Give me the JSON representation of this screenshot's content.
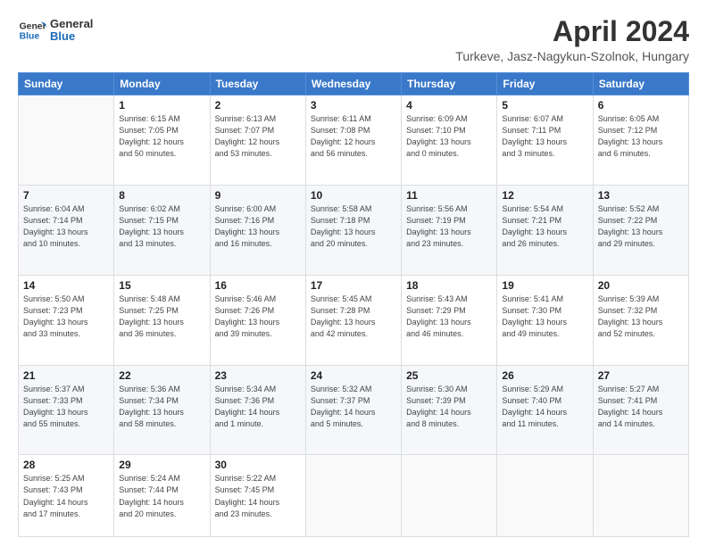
{
  "header": {
    "logo_line1": "General",
    "logo_line2": "Blue",
    "month": "April 2024",
    "location": "Turkeve, Jasz-Nagykun-Szolnok, Hungary"
  },
  "weekdays": [
    "Sunday",
    "Monday",
    "Tuesday",
    "Wednesday",
    "Thursday",
    "Friday",
    "Saturday"
  ],
  "weeks": [
    [
      {
        "day": "",
        "info": ""
      },
      {
        "day": "1",
        "info": "Sunrise: 6:15 AM\nSunset: 7:05 PM\nDaylight: 12 hours\nand 50 minutes."
      },
      {
        "day": "2",
        "info": "Sunrise: 6:13 AM\nSunset: 7:07 PM\nDaylight: 12 hours\nand 53 minutes."
      },
      {
        "day": "3",
        "info": "Sunrise: 6:11 AM\nSunset: 7:08 PM\nDaylight: 12 hours\nand 56 minutes."
      },
      {
        "day": "4",
        "info": "Sunrise: 6:09 AM\nSunset: 7:10 PM\nDaylight: 13 hours\nand 0 minutes."
      },
      {
        "day": "5",
        "info": "Sunrise: 6:07 AM\nSunset: 7:11 PM\nDaylight: 13 hours\nand 3 minutes."
      },
      {
        "day": "6",
        "info": "Sunrise: 6:05 AM\nSunset: 7:12 PM\nDaylight: 13 hours\nand 6 minutes."
      }
    ],
    [
      {
        "day": "7",
        "info": "Sunrise: 6:04 AM\nSunset: 7:14 PM\nDaylight: 13 hours\nand 10 minutes."
      },
      {
        "day": "8",
        "info": "Sunrise: 6:02 AM\nSunset: 7:15 PM\nDaylight: 13 hours\nand 13 minutes."
      },
      {
        "day": "9",
        "info": "Sunrise: 6:00 AM\nSunset: 7:16 PM\nDaylight: 13 hours\nand 16 minutes."
      },
      {
        "day": "10",
        "info": "Sunrise: 5:58 AM\nSunset: 7:18 PM\nDaylight: 13 hours\nand 20 minutes."
      },
      {
        "day": "11",
        "info": "Sunrise: 5:56 AM\nSunset: 7:19 PM\nDaylight: 13 hours\nand 23 minutes."
      },
      {
        "day": "12",
        "info": "Sunrise: 5:54 AM\nSunset: 7:21 PM\nDaylight: 13 hours\nand 26 minutes."
      },
      {
        "day": "13",
        "info": "Sunrise: 5:52 AM\nSunset: 7:22 PM\nDaylight: 13 hours\nand 29 minutes."
      }
    ],
    [
      {
        "day": "14",
        "info": "Sunrise: 5:50 AM\nSunset: 7:23 PM\nDaylight: 13 hours\nand 33 minutes."
      },
      {
        "day": "15",
        "info": "Sunrise: 5:48 AM\nSunset: 7:25 PM\nDaylight: 13 hours\nand 36 minutes."
      },
      {
        "day": "16",
        "info": "Sunrise: 5:46 AM\nSunset: 7:26 PM\nDaylight: 13 hours\nand 39 minutes."
      },
      {
        "day": "17",
        "info": "Sunrise: 5:45 AM\nSunset: 7:28 PM\nDaylight: 13 hours\nand 42 minutes."
      },
      {
        "day": "18",
        "info": "Sunrise: 5:43 AM\nSunset: 7:29 PM\nDaylight: 13 hours\nand 46 minutes."
      },
      {
        "day": "19",
        "info": "Sunrise: 5:41 AM\nSunset: 7:30 PM\nDaylight: 13 hours\nand 49 minutes."
      },
      {
        "day": "20",
        "info": "Sunrise: 5:39 AM\nSunset: 7:32 PM\nDaylight: 13 hours\nand 52 minutes."
      }
    ],
    [
      {
        "day": "21",
        "info": "Sunrise: 5:37 AM\nSunset: 7:33 PM\nDaylight: 13 hours\nand 55 minutes."
      },
      {
        "day": "22",
        "info": "Sunrise: 5:36 AM\nSunset: 7:34 PM\nDaylight: 13 hours\nand 58 minutes."
      },
      {
        "day": "23",
        "info": "Sunrise: 5:34 AM\nSunset: 7:36 PM\nDaylight: 14 hours\nand 1 minute."
      },
      {
        "day": "24",
        "info": "Sunrise: 5:32 AM\nSunset: 7:37 PM\nDaylight: 14 hours\nand 5 minutes."
      },
      {
        "day": "25",
        "info": "Sunrise: 5:30 AM\nSunset: 7:39 PM\nDaylight: 14 hours\nand 8 minutes."
      },
      {
        "day": "26",
        "info": "Sunrise: 5:29 AM\nSunset: 7:40 PM\nDaylight: 14 hours\nand 11 minutes."
      },
      {
        "day": "27",
        "info": "Sunrise: 5:27 AM\nSunset: 7:41 PM\nDaylight: 14 hours\nand 14 minutes."
      }
    ],
    [
      {
        "day": "28",
        "info": "Sunrise: 5:25 AM\nSunset: 7:43 PM\nDaylight: 14 hours\nand 17 minutes."
      },
      {
        "day": "29",
        "info": "Sunrise: 5:24 AM\nSunset: 7:44 PM\nDaylight: 14 hours\nand 20 minutes."
      },
      {
        "day": "30",
        "info": "Sunrise: 5:22 AM\nSunset: 7:45 PM\nDaylight: 14 hours\nand 23 minutes."
      },
      {
        "day": "",
        "info": ""
      },
      {
        "day": "",
        "info": ""
      },
      {
        "day": "",
        "info": ""
      },
      {
        "day": "",
        "info": ""
      }
    ]
  ]
}
